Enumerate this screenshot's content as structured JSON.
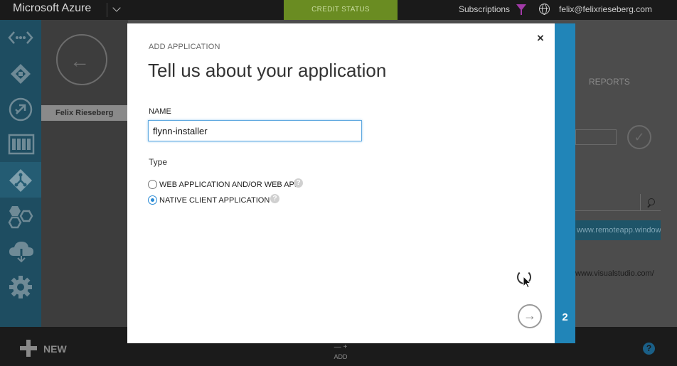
{
  "topbar": {
    "brand": "Microsoft Azure",
    "credit_status": "CREDIT STATUS",
    "subscriptions": "Subscriptions",
    "user_email": "felix@felixrieseberg.com"
  },
  "leftnav": {
    "items": [
      {
        "icon": "dots-arrows-icon"
      },
      {
        "icon": "puzzle-icon"
      },
      {
        "icon": "remote-app-icon"
      },
      {
        "icon": "grid-panel-icon"
      },
      {
        "icon": "active-directory-icon"
      },
      {
        "icon": "hexagons-icon"
      },
      {
        "icon": "cloud-download-icon"
      },
      {
        "icon": "gear-icon"
      }
    ],
    "active_index": 4
  },
  "background": {
    "user_name": "Felix Rieseberg",
    "reports_tab": "REPORTS",
    "remoteapp_link": "www.remoteapp.window...",
    "visualstudio_link": "www.visualstudio.com/"
  },
  "bottombar": {
    "new_label": "NEW",
    "add_icon": "— +",
    "add_label": "ADD",
    "help": "?"
  },
  "modal": {
    "kicker": "ADD APPLICATION",
    "title": "Tell us about your application",
    "close": "×",
    "name_label": "NAME",
    "name_value": "flynn-installer",
    "type_label": "Type",
    "options": [
      {
        "label": "WEB APPLICATION AND/OR WEB API",
        "selected": false
      },
      {
        "label": "NATIVE CLIENT APPLICATION",
        "selected": true
      }
    ],
    "help_glyph": "?",
    "next_arrow": "→",
    "step_number": "2"
  },
  "colors": {
    "accent": "#2185b8",
    "nav_bg": "#1e4d61",
    "credit_bg": "#6a8c22"
  }
}
